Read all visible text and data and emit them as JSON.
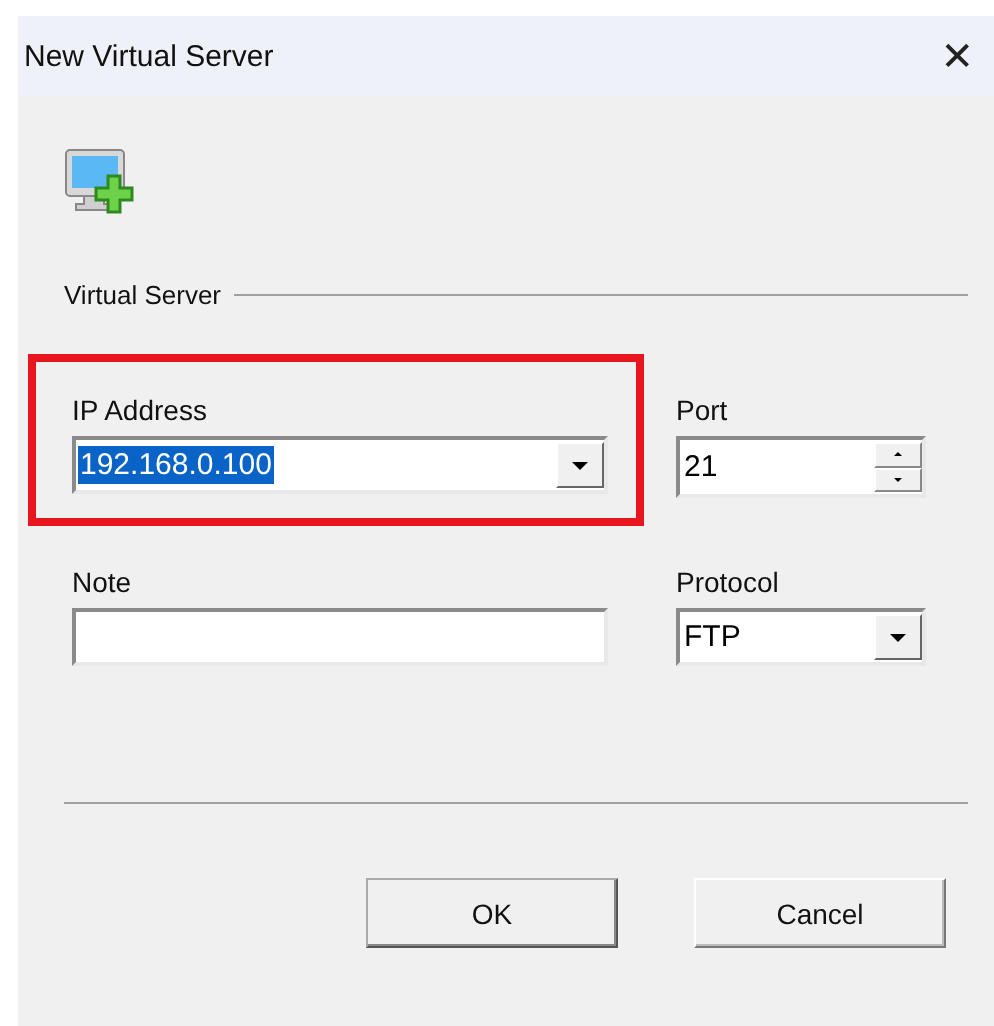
{
  "window": {
    "title": "New Virtual Server",
    "close_glyph": "✕"
  },
  "section": {
    "title": "Virtual Server"
  },
  "ip_address": {
    "label": "IP Address",
    "value": "192.168.0.100",
    "text_selected": true,
    "outlined": true
  },
  "port": {
    "label": "Port",
    "value": "21"
  },
  "note": {
    "label": "Note"
  },
  "protocol": {
    "label": "Protocol",
    "value": "FTP"
  },
  "buttons": [
    {
      "label": "OK",
      "default": true
    },
    {
      "label": "Cancel",
      "default": false
    }
  ]
}
